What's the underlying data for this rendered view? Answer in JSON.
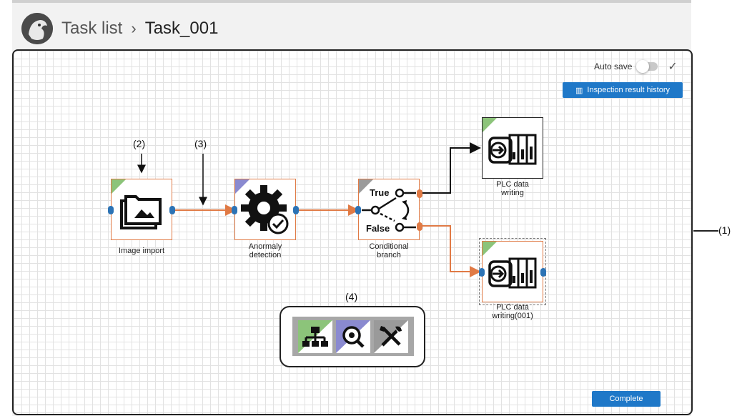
{
  "header": {
    "breadcrumb_root": "Task list",
    "separator": "›",
    "current": "Task_001"
  },
  "toolbar": {
    "auto_save_label": "Auto save",
    "auto_save_on": false,
    "history_label": "Inspection result history",
    "complete_label": "Complete"
  },
  "nodes": [
    {
      "label_1": "Image import",
      "label_2": "",
      "icon": "image-import-icon",
      "corner_color": "#8cc47a"
    },
    {
      "label_1": "Anormaly",
      "label_2": "detection",
      "icon": "gear-check-icon",
      "corner_color": "#8a8ad0"
    },
    {
      "label_1": "Conditional",
      "label_2": "branch",
      "icon": "branch-icon",
      "corner_color": "#9a9a9a",
      "true_label": "True",
      "false_label": "False"
    },
    {
      "label_1": "PLC data",
      "label_2": "writing",
      "icon": "plc-icon",
      "corner_color": "#8cc47a"
    },
    {
      "label_1": "PLC data",
      "label_2": "writing(001)",
      "icon": "plc-icon",
      "corner_color": "#8cc47a"
    }
  ],
  "annotations": {
    "a1": "(1)",
    "a2": "(2)",
    "a3": "(3)",
    "a4": "(4)"
  },
  "palette": [
    {
      "icon": "flow-tree-icon",
      "color": "#8cc47a"
    },
    {
      "icon": "inspection-icon",
      "color": "#8a8ad0"
    },
    {
      "icon": "tools-icon",
      "color": "#9a9a9a"
    }
  ],
  "colors": {
    "accent": "#1f78c8",
    "node_border": "#e07a45",
    "port": "#2c73b5",
    "connector": "#e07a45"
  }
}
